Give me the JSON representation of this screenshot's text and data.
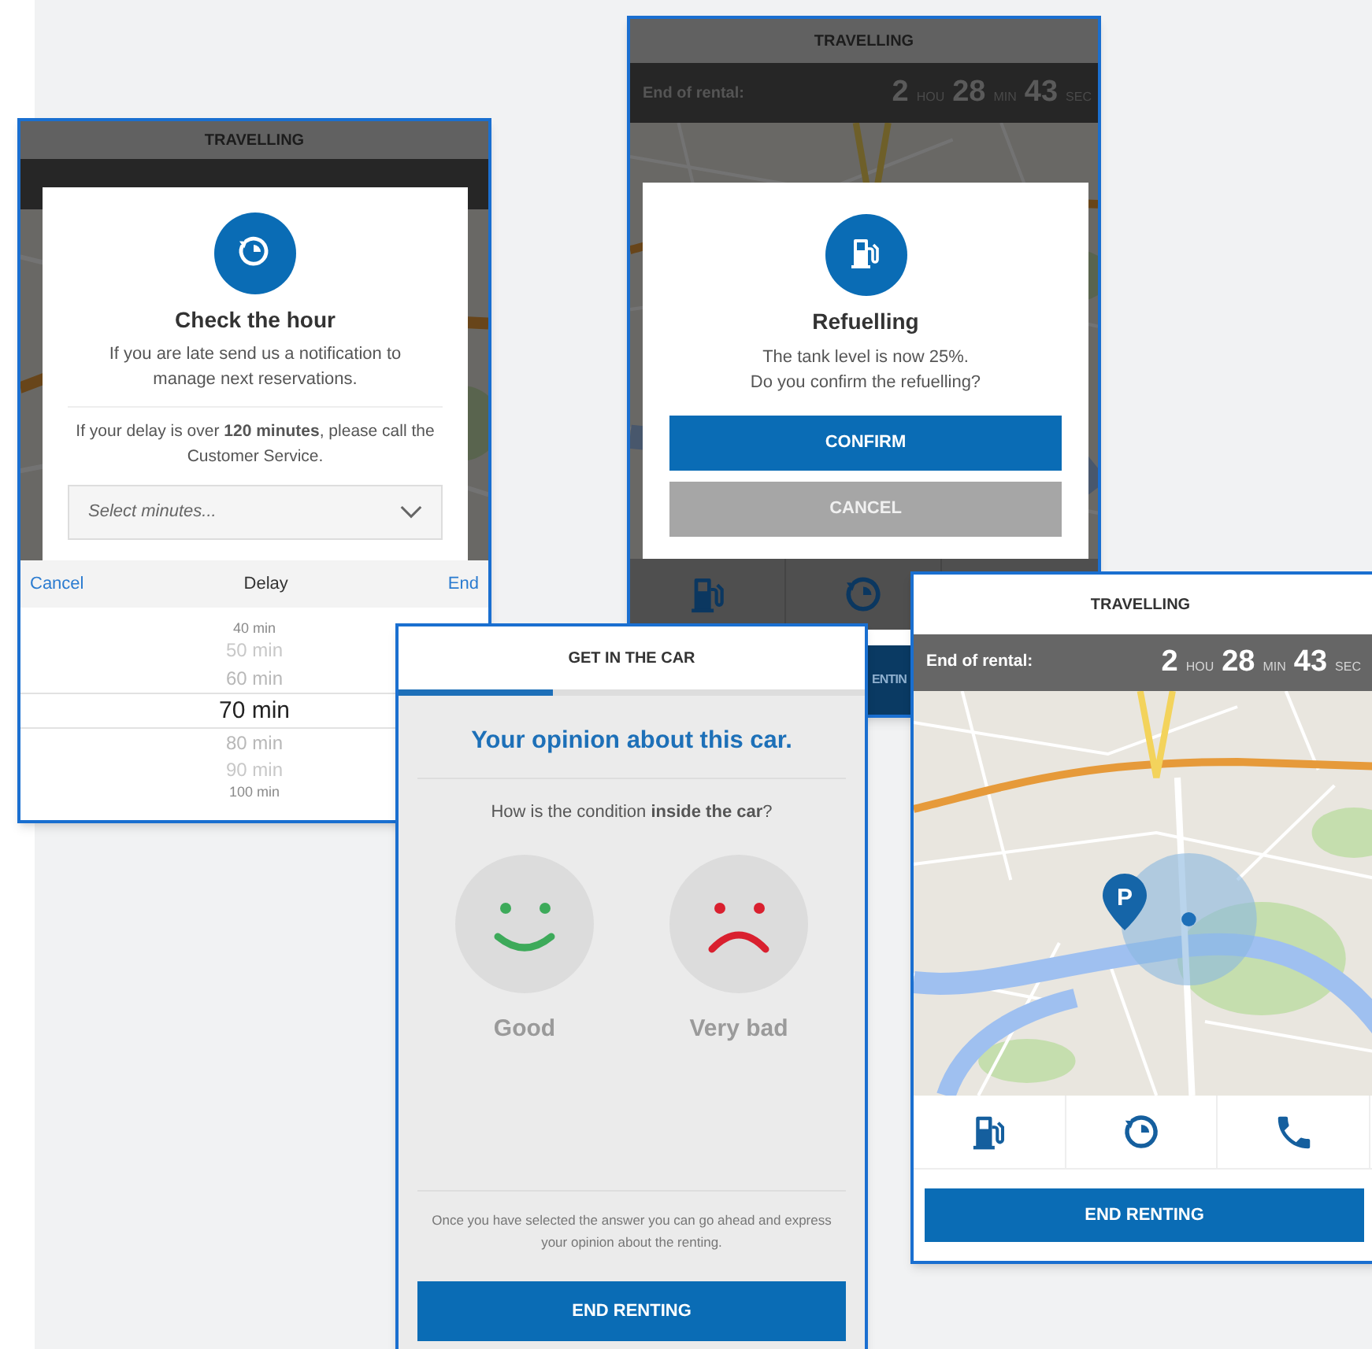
{
  "check_hour_screen": {
    "header_title": "TRAVELLING",
    "dialog": {
      "title": "Check the hour",
      "message": "If you are late send us a notification to manage next reservations.",
      "note": "If your delay is over **120 minutes**, please call the Customer Service.",
      "select": {
        "placeholder": "Select minutes..."
      }
    },
    "picker": {
      "cancel": "Cancel",
      "title": "Delay",
      "done": "End",
      "options": [
        {
          "label": "40 min",
          "selected": false
        },
        {
          "label": "50 min",
          "selected": false
        },
        {
          "label": "60 min",
          "selected": false
        },
        {
          "label": "70 min",
          "selected": true
        },
        {
          "label": "80 min",
          "selected": false
        },
        {
          "label": "90 min",
          "selected": false
        },
        {
          "label": "100 min",
          "selected": false
        }
      ]
    }
  },
  "refuelling_screen": {
    "header_title": "TRAVELLING",
    "timer": {
      "label": "End of rental:",
      "parts": [
        {
          "value": "2",
          "unit": "HOU"
        },
        {
          "value": "28",
          "unit": "MIN"
        },
        {
          "value": "43",
          "unit": "SEC"
        }
      ]
    },
    "dialog": {
      "title": "Refuelling",
      "lines": [
        "The tank level is now 25%.",
        "Do you confirm the refuelling?"
      ],
      "buttons": [
        {
          "label": "CONFIRM",
          "kind": "primary"
        },
        {
          "label": "CANCEL",
          "kind": "secondary"
        }
      ]
    },
    "end_button": "ENTIN"
  },
  "opinion_screen": {
    "header_title": "GET IN THE CAR",
    "progress": {
      "level": 0.33
    },
    "title": "Your opinion about this car.",
    "question": "How is the condition **inside the car**?",
    "answers": [
      {
        "label": "Good",
        "kind": "happy"
      },
      {
        "label": "Very bad",
        "kind": "sad"
      }
    ],
    "note": "Once you have selected the answer you can go ahead and express your opinion about the renting.",
    "button": "END RENTING"
  },
  "travelling_screen": {
    "header_title": "TRAVELLING",
    "timer": {
      "label": "End of rental:",
      "parts": [
        {
          "value": "2",
          "unit": "HOU"
        },
        {
          "value": "28",
          "unit": "MIN"
        },
        {
          "value": "43",
          "unit": "SEC"
        }
      ]
    },
    "map": {
      "pin_label": "P"
    },
    "button": "END RENTING"
  }
}
